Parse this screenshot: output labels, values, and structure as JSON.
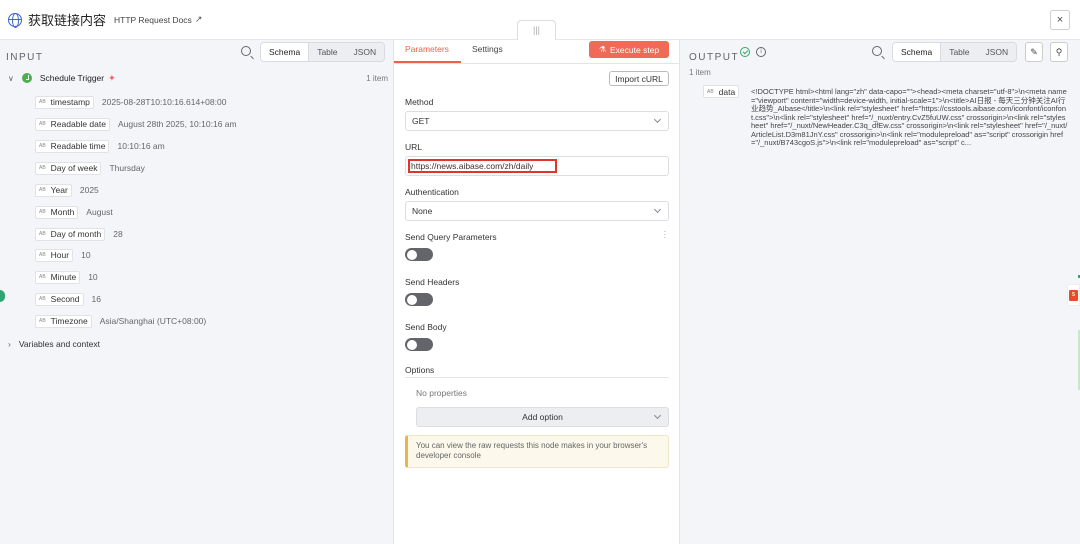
{
  "header": {
    "title": "获取链接内容",
    "docs_link": "HTTP Request Docs",
    "close_label": "×",
    "drag_handle": "|||"
  },
  "input": {
    "heading": "INPUT",
    "view_tabs": [
      "Schema",
      "Table",
      "JSON"
    ],
    "trigger_name": "Schedule Trigger",
    "item_count": "1 item",
    "fields": [
      {
        "name": "timestamp",
        "value": "2025-08-28T10:10:16.614+08:00"
      },
      {
        "name": "Readable date",
        "value": "August 28th 2025, 10:10:16 am"
      },
      {
        "name": "Readable time",
        "value": "10:10:16 am"
      },
      {
        "name": "Day of week",
        "value": "Thursday"
      },
      {
        "name": "Year",
        "value": "2025"
      },
      {
        "name": "Month",
        "value": "August"
      },
      {
        "name": "Day of month",
        "value": "28"
      },
      {
        "name": "Hour",
        "value": "10"
      },
      {
        "name": "Minute",
        "value": "10"
      },
      {
        "name": "Second",
        "value": "16"
      },
      {
        "name": "Timezone",
        "value": "Asia/Shanghai (UTC+08:00)"
      }
    ],
    "type_badge": "AB",
    "variables_label": "Variables and context"
  },
  "params": {
    "tabs": [
      "Parameters",
      "Settings"
    ],
    "execute_label": "Execute step",
    "import_curl": "Import cURL",
    "method_label": "Method",
    "method_value": "GET",
    "url_label": "URL",
    "url_value": "https://news.aibase.com/zh/daily",
    "auth_label": "Authentication",
    "auth_value": "None",
    "send_query_label": "Send Query Parameters",
    "send_headers_label": "Send Headers",
    "send_body_label": "Send Body",
    "send_query_on": false,
    "send_headers_on": false,
    "send_body_on": false,
    "options_label": "Options",
    "no_properties": "No properties",
    "add_option": "Add option",
    "notice": "You can view the raw requests this node makes in your browser's developer console"
  },
  "output": {
    "heading": "OUTPUT",
    "view_tabs": [
      "Schema",
      "Table",
      "JSON"
    ],
    "item_count": "1 item",
    "field_name": "data",
    "type_badge": "AB",
    "field_value": "<!DOCTYPE html><html lang=\"zh\" data-capo=\"\"><head><meta charset=\"utf-8\">\\n<meta name=\"viewport\" content=\"width=device-width, initial-scale=1\">\\n<title>AI日报 - 每天三分钟关注AI行业趋势_AIbase</title>\\n<link rel=\"stylesheet\" href=\"https://csstools.aibase.com/iconfont/iconfont.css\">\\n<link rel=\"stylesheet\" href=\"/_nuxt/entry.CvZ5fuUW.css\" crossorigin>\\n<link rel=\"stylesheet\" href=\"/_nuxt/NewHeader.C3q_dfEw.css\" crossorigin>\\n<link rel=\"stylesheet\" href=\"/_nuxt/ArticleList.D3m81JnY.css\" crossorigin>\\n<link rel=\"modulepreload\" as=\"script\" crossorigin href=\"/_nuxt/B743cgoS.js\">\\n<link rel=\"modulepreload\" as=\"script\" c..."
  },
  "colors": {
    "accent": "#ef6a57",
    "success": "#35a86a",
    "trigger": "#4caf50",
    "highlight": "#e0342c"
  }
}
